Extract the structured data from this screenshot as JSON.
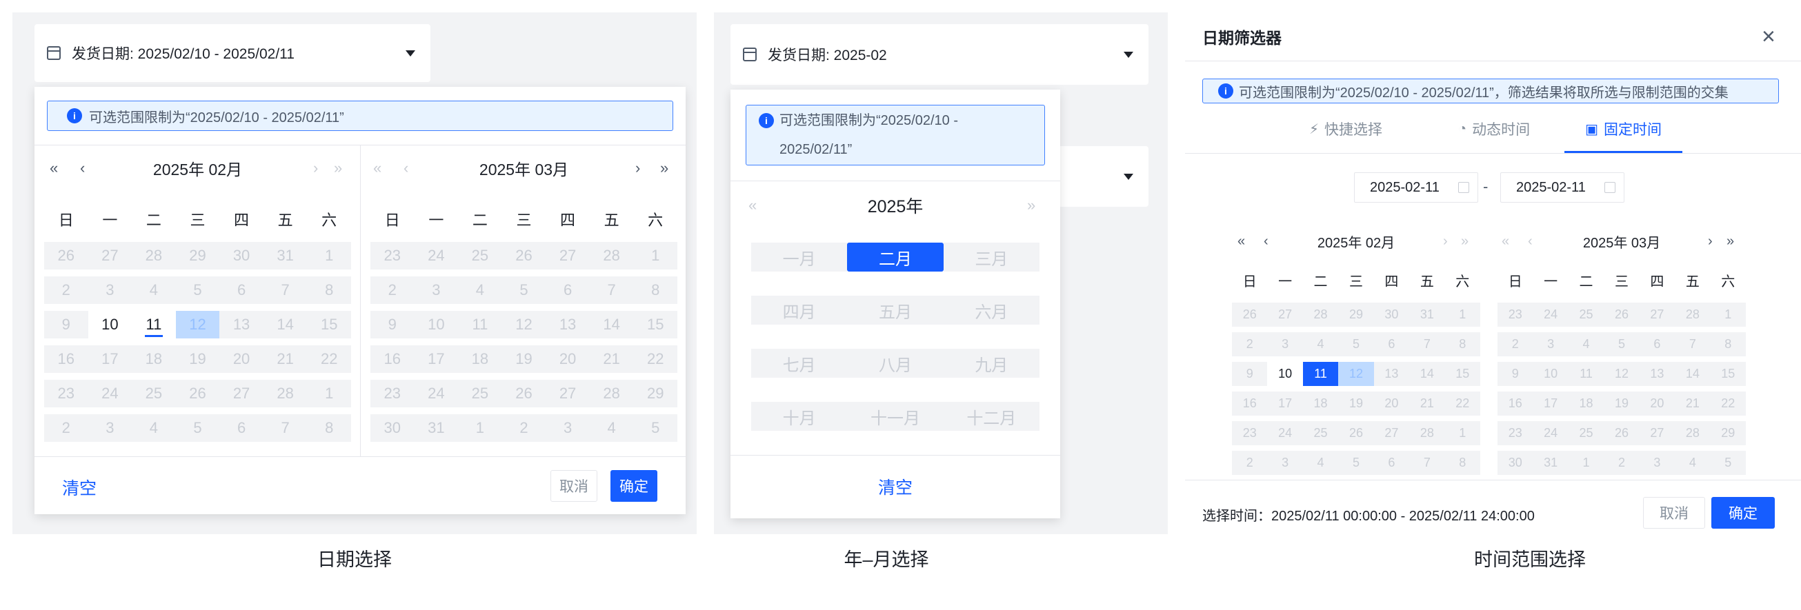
{
  "panel1": {
    "select_label": "发货日期: 2025/02/10 - 2025/02/11",
    "alert": "可选范围限制为“2025/02/10 - 2025/02/11”",
    "left_month": "2025年 02月",
    "right_month": "2025年 03月",
    "clear": "清空",
    "cancel": "取消",
    "ok": "确定",
    "caption": "日期选择"
  },
  "panel2": {
    "select_label": "发货日期: 2025-02",
    "alert_line1": "可选范围限制为“2025/02/10 -",
    "alert_line2": "2025/02/11”",
    "year": "2025年",
    "months": [
      "一月",
      "二月",
      "三月",
      "四月",
      "五月",
      "六月",
      "七月",
      "八月",
      "九月",
      "十月",
      "十一月",
      "十二月"
    ],
    "selected_month_index": 1,
    "clear": "清空",
    "caption": "年–月选择"
  },
  "panel3": {
    "title": "日期筛选器",
    "alert": "可选范围限制为“2025/02/10 - 2025/02/11”，筛选结果将取所选与限制范围的交集",
    "tabs": [
      "快捷选择",
      "动态时间",
      "固定时间"
    ],
    "start_date": "2025-02-11",
    "end_date": "2025-02-11",
    "range_sep": "-",
    "left_month": "2025年 02月",
    "right_month": "2025年 03月",
    "selected_time": "选择时间：2025/02/11 00:00:00 - 2025/02/11 24:00:00",
    "cancel": "取消",
    "ok": "确定",
    "caption": "时间范围选择"
  },
  "weekdays": [
    "日",
    "一",
    "二",
    "三",
    "四",
    "五",
    "六"
  ],
  "nav": {
    "prev_year": "«",
    "prev_month": "‹",
    "next_month": "›",
    "next_year": "»"
  },
  "feb_days": [
    "26",
    "27",
    "28",
    "29",
    "30",
    "31",
    "1",
    "2",
    "3",
    "4",
    "5",
    "6",
    "7",
    "8",
    "9",
    "10",
    "11",
    "12",
    "13",
    "14",
    "15",
    "16",
    "17",
    "18",
    "19",
    "20",
    "21",
    "22",
    "23",
    "24",
    "25",
    "26",
    "27",
    "28",
    "1",
    "2",
    "3",
    "4",
    "5",
    "6",
    "7",
    "8"
  ],
  "mar_days": [
    "23",
    "24",
    "25",
    "26",
    "27",
    "28",
    "1",
    "2",
    "3",
    "4",
    "5",
    "6",
    "7",
    "8",
    "9",
    "10",
    "11",
    "12",
    "13",
    "14",
    "15",
    "16",
    "17",
    "18",
    "19",
    "20",
    "21",
    "22",
    "23",
    "24",
    "25",
    "26",
    "27",
    "28",
    "29",
    "30",
    "31",
    "1",
    "2",
    "3",
    "4",
    "5"
  ],
  "colors": {
    "primary": "#165dff",
    "disabled": "#c9cdd4",
    "range_light": "#bedaff",
    "panel_bg": "#f2f3f5"
  }
}
